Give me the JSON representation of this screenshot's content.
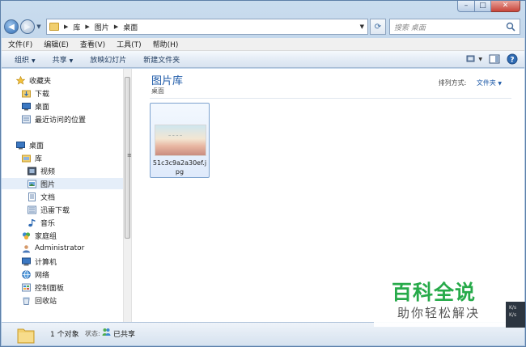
{
  "address": {
    "breadcrumbs": [
      "库",
      "图片",
      "桌面"
    ],
    "search_placeholder": "搜索 桌面"
  },
  "menu": [
    "文件(F)",
    "编辑(E)",
    "查看(V)",
    "工具(T)",
    "帮助(H)"
  ],
  "toolbar": {
    "organize": "组织",
    "share": "共享",
    "slideshow": "放映幻灯片",
    "new_folder": "新建文件夹"
  },
  "nav": {
    "favorites": "收藏夹",
    "downloads": "下载",
    "desktop_fav": "桌面",
    "recent": "最近访问的位置",
    "desktop": "桌面",
    "libraries": "库",
    "videos": "视频",
    "pictures": "图片",
    "documents": "文档",
    "xunlei": "迅雷下载",
    "music": "音乐",
    "homegroup": "家庭组",
    "user": "Administrator",
    "computer": "计算机",
    "network": "网络",
    "control_panel": "控制面板",
    "recycle_bin": "回收站"
  },
  "main": {
    "library_title": "图片库",
    "library_subtitle": "桌面",
    "sort_label": "排列方式:",
    "sort_value": "文件夹",
    "files": [
      {
        "name": "51c3c9a2a30ef.jpg"
      }
    ]
  },
  "status": {
    "count": "1 个对象",
    "state_label": "状态:",
    "state_value": "已共享"
  },
  "watermark": {
    "title": "百科全说",
    "subtitle": "助你轻松解决"
  },
  "edge_text": [
    "K/s",
    "K/s"
  ],
  "colors": {
    "accent": "#1e5aa8",
    "watermark_green": "#27aa4a"
  }
}
